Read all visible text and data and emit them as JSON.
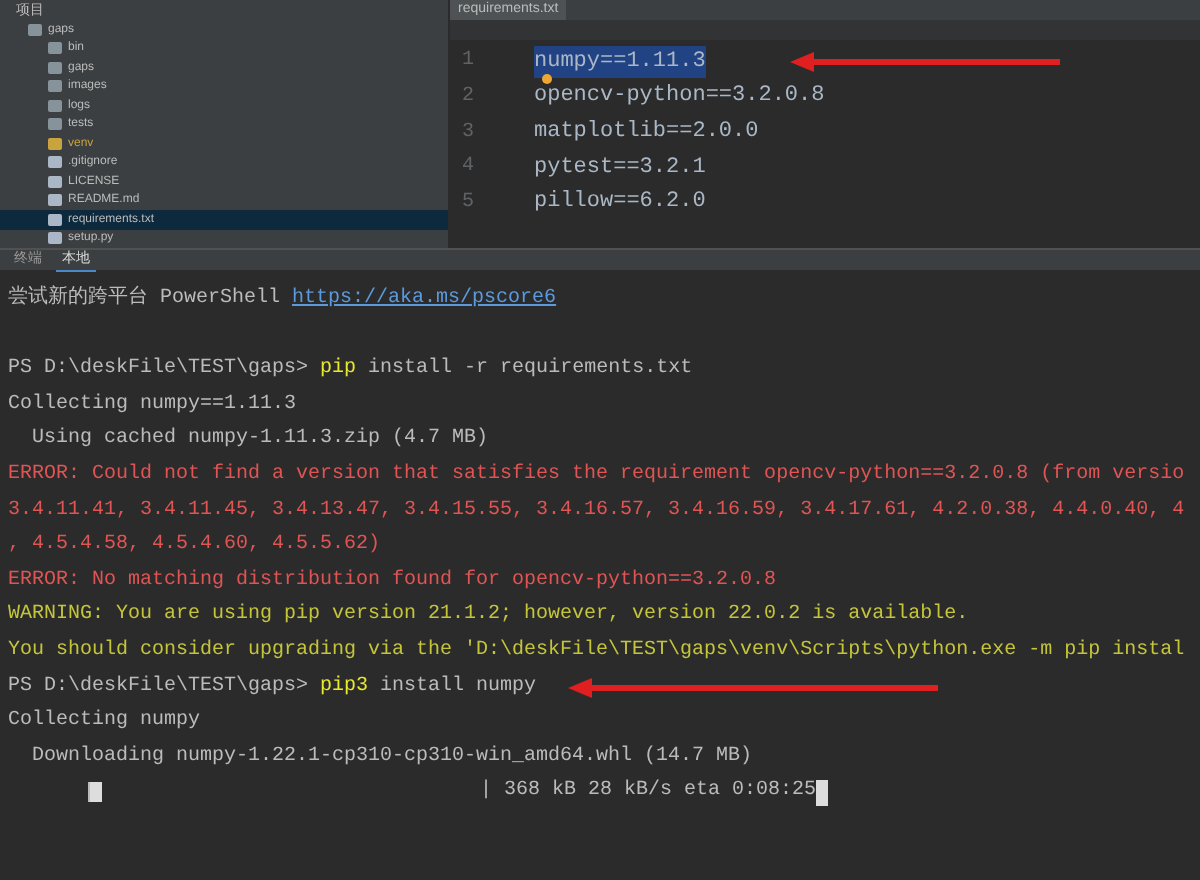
{
  "project_panel": {
    "title": "项目",
    "tree": [
      {
        "label": "gaps",
        "kind": "folder",
        "selected": false,
        "children": [
          {
            "label": "bin",
            "kind": "folder",
            "selected": false
          },
          {
            "label": "gaps",
            "kind": "folder",
            "selected": false
          },
          {
            "label": "images",
            "kind": "folder",
            "selected": false
          },
          {
            "label": "logs",
            "kind": "folder",
            "selected": false
          },
          {
            "label": "tests",
            "kind": "folder",
            "selected": false
          },
          {
            "label": "venv",
            "kind": "venv",
            "selected": false
          },
          {
            "label": ".gitignore",
            "kind": "file",
            "selected": false
          },
          {
            "label": "LICENSE",
            "kind": "file",
            "selected": false
          },
          {
            "label": "README.md",
            "kind": "file",
            "selected": false
          },
          {
            "label": "requirements.txt",
            "kind": "file",
            "selected": true
          },
          {
            "label": "setup.py",
            "kind": "file",
            "selected": false
          }
        ]
      }
    ]
  },
  "editor": {
    "tab": "requirements.txt",
    "lines": [
      {
        "number": "1",
        "text": "numpy==1.11.3",
        "arrow": true
      },
      {
        "number": "2",
        "text": "opencv-python==3.2.0.8",
        "arrow": false
      },
      {
        "number": "3",
        "text": "matplotlib==2.0.0",
        "arrow": false
      },
      {
        "number": "4",
        "text": "pytest==3.2.1",
        "arrow": false
      },
      {
        "number": "5",
        "text": "pillow==6.2.0",
        "arrow": false
      }
    ]
  },
  "terminal": {
    "tabs": [
      {
        "label": "终端",
        "selected": false
      },
      {
        "label": "本地",
        "selected": true
      }
    ],
    "lines": [
      {
        "arrow": false,
        "segments": [
          {
            "kind": "plain",
            "text": "尝试新的跨平台 PowerShell "
          },
          {
            "kind": "link",
            "text": "https://aka.ms/pscore6"
          }
        ]
      },
      {
        "arrow": false
      },
      {
        "arrow": false,
        "segments": [
          {
            "kind": "plain",
            "text": "PS D:\\deskFile\\TEST\\gaps> "
          },
          {
            "kind": "command",
            "text": "pip"
          },
          {
            "kind": "plain",
            "text": " install -r requirements.txt"
          }
        ]
      },
      {
        "arrow": false,
        "segments": [
          {
            "kind": "plain",
            "text": "Collecting numpy==1.11.3"
          }
        ]
      },
      {
        "arrow": false,
        "segments": [
          {
            "kind": "plain",
            "text": "  Using cached numpy-1.11.3.zip (4.7 MB)"
          }
        ]
      },
      {
        "arrow": false,
        "segments": [
          {
            "kind": "error",
            "text": "ERROR: Could not find a version that satisfies the requirement opencv-python==3.2.0.8 (from versio"
          }
        ]
      },
      {
        "arrow": false,
        "segments": [
          {
            "kind": "error",
            "text": "3.4.11.41, 3.4.11.45, 3.4.13.47, 3.4.15.55, 3.4.16.57, 3.4.16.59, 3.4.17.61, 4.2.0.38, 4.4.0.40, 4"
          }
        ]
      },
      {
        "arrow": false,
        "segments": [
          {
            "kind": "error",
            "text": ", 4.5.4.58, 4.5.4.60, 4.5.5.62)"
          }
        ]
      },
      {
        "arrow": false,
        "segments": [
          {
            "kind": "error",
            "text": "ERROR: No matching distribution found for opencv-python==3.2.0.8"
          }
        ]
      },
      {
        "arrow": false,
        "segments": [
          {
            "kind": "warning",
            "text": "WARNING: You are using pip version 21.1.2; however, version 22.0.2 is available."
          }
        ]
      },
      {
        "arrow": false,
        "segments": [
          {
            "kind": "warning",
            "text": "You should consider upgrading via the 'D:\\deskFile\\TEST\\gaps\\venv\\Scripts\\python.exe -m pip instal"
          }
        ]
      },
      {
        "arrow": true,
        "segments": [
          {
            "kind": "plain",
            "text": "PS D:\\deskFile\\TEST\\gaps> "
          },
          {
            "kind": "command",
            "text": "pip3"
          },
          {
            "kind": "plain",
            "text": " install numpy"
          }
        ]
      },
      {
        "arrow": false,
        "segments": [
          {
            "kind": "plain",
            "text": "Collecting numpy"
          }
        ]
      },
      {
        "arrow": false,
        "segments": [
          {
            "kind": "plain",
            "text": "  Downloading numpy-1.22.1-cp310-cp310-win_amd64.whl (14.7 MB)"
          }
        ]
      }
    ],
    "progress": {
      "level": 0.03,
      "reading": "| 368 kB 28 kB/s eta 0:08:25"
    }
  }
}
